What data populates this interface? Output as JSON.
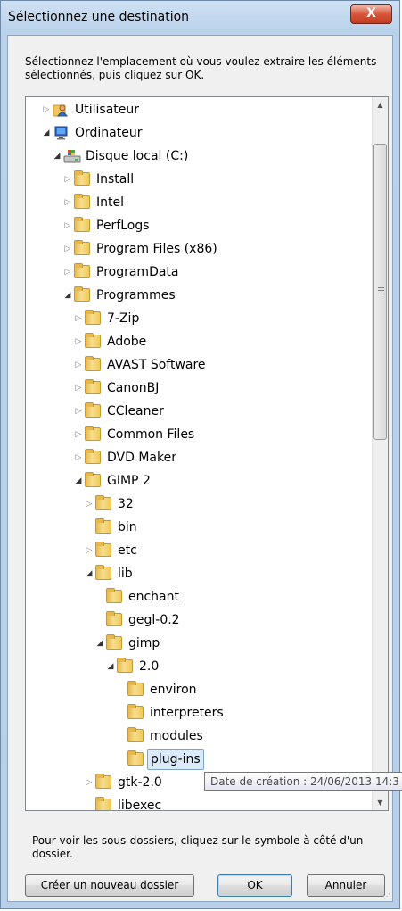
{
  "dialog": {
    "title": "Sélectionnez une destination",
    "close_label": "X",
    "instructions": "Sélectionnez l'emplacement où vous voulez extraire les éléments sélectionnés, puis cliquez sur OK.",
    "hint": "Pour voir les sous-dossiers, cliquez sur le symbole à côté d'un dossier.",
    "tooltip": "Date de création : 24/06/2013 14:3"
  },
  "buttons": {
    "new_folder": "Créer un nouveau dossier",
    "ok": "OK",
    "cancel": "Annuler"
  },
  "tree": {
    "items": [
      {
        "label": "Utilisateur",
        "icon": "user-icon",
        "level": 0,
        "expander": "collapsed"
      },
      {
        "label": "Ordinateur",
        "icon": "computer-icon",
        "level": 0,
        "expander": "expanded"
      },
      {
        "label": "Disque local (C:)",
        "icon": "drive-icon",
        "level": 1,
        "expander": "expanded"
      },
      {
        "label": "Install",
        "icon": "folder-icon",
        "level": 2,
        "expander": "collapsed"
      },
      {
        "label": "Intel",
        "icon": "folder-icon",
        "level": 2,
        "expander": "collapsed"
      },
      {
        "label": "PerfLogs",
        "icon": "folder-icon",
        "level": 2,
        "expander": "collapsed"
      },
      {
        "label": "Program Files (x86)",
        "icon": "folder-icon",
        "level": 2,
        "expander": "collapsed"
      },
      {
        "label": "ProgramData",
        "icon": "folder-icon",
        "level": 2,
        "expander": "collapsed"
      },
      {
        "label": "Programmes",
        "icon": "folder-icon",
        "level": 2,
        "expander": "expanded"
      },
      {
        "label": "7-Zip",
        "icon": "folder-icon",
        "level": 3,
        "expander": "collapsed"
      },
      {
        "label": "Adobe",
        "icon": "folder-icon",
        "level": 3,
        "expander": "collapsed"
      },
      {
        "label": "AVAST Software",
        "icon": "folder-icon",
        "level": 3,
        "expander": "collapsed"
      },
      {
        "label": "CanonBJ",
        "icon": "folder-icon",
        "level": 3,
        "expander": "collapsed"
      },
      {
        "label": "CCleaner",
        "icon": "folder-icon",
        "level": 3,
        "expander": "collapsed"
      },
      {
        "label": "Common Files",
        "icon": "folder-icon",
        "level": 3,
        "expander": "collapsed"
      },
      {
        "label": "DVD Maker",
        "icon": "folder-icon",
        "level": 3,
        "expander": "collapsed"
      },
      {
        "label": "GIMP 2",
        "icon": "folder-icon",
        "level": 3,
        "expander": "expanded"
      },
      {
        "label": "32",
        "icon": "folder-icon",
        "level": 4,
        "expander": "collapsed"
      },
      {
        "label": "bin",
        "icon": "folder-icon",
        "level": 4,
        "expander": "none"
      },
      {
        "label": "etc",
        "icon": "folder-icon",
        "level": 4,
        "expander": "collapsed"
      },
      {
        "label": "lib",
        "icon": "folder-icon",
        "level": 4,
        "expander": "expanded"
      },
      {
        "label": "enchant",
        "icon": "folder-icon",
        "level": 5,
        "expander": "none"
      },
      {
        "label": "gegl-0.2",
        "icon": "folder-icon",
        "level": 5,
        "expander": "none"
      },
      {
        "label": "gimp",
        "icon": "folder-icon",
        "level": 5,
        "expander": "expanded"
      },
      {
        "label": "2.0",
        "icon": "folder-icon",
        "level": 6,
        "expander": "expanded"
      },
      {
        "label": "environ",
        "icon": "folder-icon",
        "level": 7,
        "expander": "none"
      },
      {
        "label": "interpreters",
        "icon": "folder-icon",
        "level": 7,
        "expander": "none"
      },
      {
        "label": "modules",
        "icon": "folder-icon",
        "level": 7,
        "expander": "none"
      },
      {
        "label": "plug-ins",
        "icon": "folder-icon",
        "level": 7,
        "expander": "none",
        "selected": true
      },
      {
        "label": "gtk-2.0",
        "icon": "folder-icon",
        "level": 4,
        "expander": "collapsed"
      },
      {
        "label": "libexec",
        "icon": "folder-icon",
        "level": 4,
        "expander": "none"
      }
    ]
  },
  "colors": {
    "selection_bg": "#dcebfc",
    "selection_border": "#7da2ce",
    "title_bar": "#b9d1ea",
    "close_button": "#c23a1e"
  }
}
